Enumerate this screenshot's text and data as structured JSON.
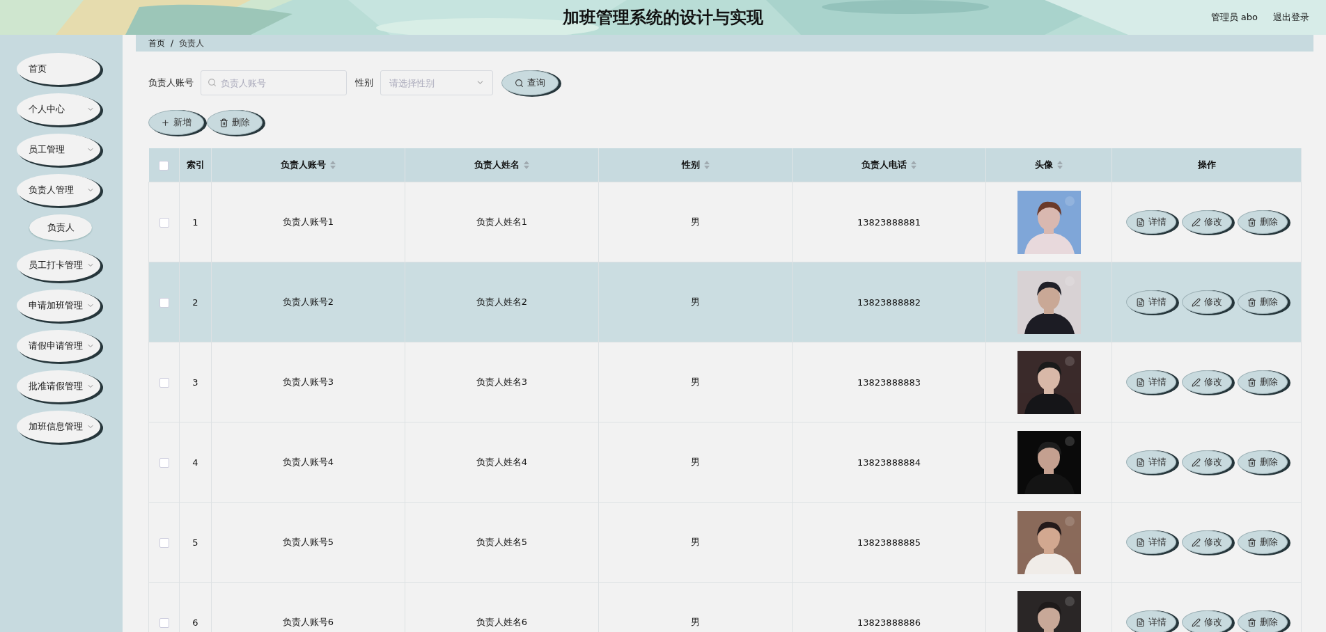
{
  "header": {
    "title": "加班管理系统的设计与实现",
    "user": "管理员 abo",
    "logout": "退出登录"
  },
  "sidebar": {
    "items": [
      {
        "label": "首页",
        "kind": "link"
      },
      {
        "label": "个人中心",
        "kind": "menu"
      },
      {
        "label": "员工管理",
        "kind": "menu"
      },
      {
        "label": "负责人管理",
        "kind": "menu",
        "children": [
          {
            "label": "负责人",
            "selected": true
          }
        ]
      },
      {
        "label": "员工打卡管理",
        "kind": "menu"
      },
      {
        "label": "申请加班管理",
        "kind": "menu"
      },
      {
        "label": "请假申请管理",
        "kind": "menu"
      },
      {
        "label": "批准请假管理",
        "kind": "menu"
      },
      {
        "label": "加班信息管理",
        "kind": "menu"
      }
    ]
  },
  "breadcrumb": {
    "items": [
      "首页",
      "负责人"
    ],
    "separator": "/"
  },
  "search": {
    "fields": [
      {
        "label": "负责人账号",
        "placeholder": "负责人账号",
        "kind": "text"
      },
      {
        "label": "性别",
        "placeholder": "请选择性别",
        "kind": "select"
      }
    ],
    "button": "查询"
  },
  "toolbar": [
    {
      "label": "新增",
      "kind": "add"
    },
    {
      "label": "删除",
      "kind": "delete"
    }
  ],
  "table": {
    "select_all_checked": false,
    "columns": [
      {
        "label": "索引",
        "sortable": false
      },
      {
        "label": "负责人账号",
        "sortable": true
      },
      {
        "label": "负责人姓名",
        "sortable": true
      },
      {
        "label": "性别",
        "sortable": true
      },
      {
        "label": "负责人电话",
        "sortable": true
      },
      {
        "label": "头像",
        "sortable": true
      },
      {
        "label": "操作",
        "sortable": false
      }
    ],
    "rows": [
      {
        "checked": false,
        "highlighted": false,
        "index": "1",
        "account": "负责人账号1",
        "name": "负责人姓名1",
        "gender": "男",
        "phone": "13823888881",
        "actions": [
          {
            "label": "详情",
            "kind": "detail"
          },
          {
            "label": "修改",
            "kind": "edit"
          },
          {
            "label": "删除",
            "kind": "delete"
          }
        ]
      },
      {
        "checked": false,
        "highlighted": true,
        "index": "2",
        "account": "负责人账号2",
        "name": "负责人姓名2",
        "gender": "男",
        "phone": "13823888882",
        "actions": [
          {
            "label": "详情",
            "kind": "detail"
          },
          {
            "label": "修改",
            "kind": "edit"
          },
          {
            "label": "删除",
            "kind": "delete"
          }
        ]
      },
      {
        "checked": false,
        "highlighted": false,
        "index": "3",
        "account": "负责人账号3",
        "name": "负责人姓名3",
        "gender": "男",
        "phone": "13823888883",
        "actions": [
          {
            "label": "详情",
            "kind": "detail"
          },
          {
            "label": "修改",
            "kind": "edit"
          },
          {
            "label": "删除",
            "kind": "delete"
          }
        ]
      },
      {
        "checked": false,
        "highlighted": false,
        "index": "4",
        "account": "负责人账号4",
        "name": "负责人姓名4",
        "gender": "男",
        "phone": "13823888884",
        "actions": [
          {
            "label": "详情",
            "kind": "detail"
          },
          {
            "label": "修改",
            "kind": "edit"
          },
          {
            "label": "删除",
            "kind": "delete"
          }
        ]
      },
      {
        "checked": false,
        "highlighted": false,
        "index": "5",
        "account": "负责人账号5",
        "name": "负责人姓名5",
        "gender": "男",
        "phone": "13823888885",
        "actions": [
          {
            "label": "详情",
            "kind": "detail"
          },
          {
            "label": "修改",
            "kind": "edit"
          },
          {
            "label": "删除",
            "kind": "delete"
          }
        ]
      },
      {
        "checked": false,
        "highlighted": false,
        "index": "6",
        "account": "负责人账号6",
        "name": "负责人姓名6",
        "gender": "男",
        "phone": "13823888886",
        "actions": [
          {
            "label": "详情",
            "kind": "detail"
          },
          {
            "label": "修改",
            "kind": "edit"
          },
          {
            "label": "删除",
            "kind": "delete"
          }
        ]
      }
    ]
  }
}
